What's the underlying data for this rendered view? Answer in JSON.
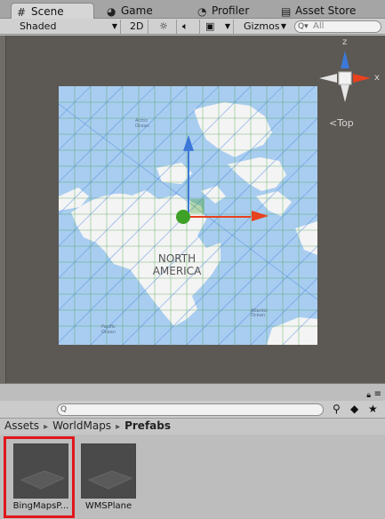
{
  "tabs": [
    {
      "label": "Scene",
      "icon": "hash-icon"
    },
    {
      "label": "Game",
      "icon": "pacman-icon"
    },
    {
      "label": "Profiler",
      "icon": "profiler-icon"
    },
    {
      "label": "Asset Store",
      "icon": "store-icon"
    }
  ],
  "toolbar": {
    "shading_mode": "Shaded",
    "mode_2d": "2D",
    "gizmos": "Gizmos",
    "search_placeholder": "All"
  },
  "scene": {
    "view_label": "Top",
    "axis_labels": {
      "x": "x",
      "z": "z"
    },
    "map_labels": {
      "continent": "NORTH\nAMERICA",
      "arctic_ocean": "Arctic\nOcean",
      "atlantic_ocean": "Atlantic\nOcean",
      "pacific_ocean": "Pacific\nOcean"
    },
    "colors": {
      "background": "#5c5853",
      "ocean": "#a9cdf0",
      "land": "#f4f4f4",
      "x_axis": "#e8411e",
      "y_axis": "#3d78d8",
      "pivot": "#3fa027"
    }
  },
  "project": {
    "breadcrumb": [
      "Assets",
      "WorldMaps",
      "Prefabs"
    ],
    "items": [
      {
        "label": "BingMapsP...",
        "selected": true
      },
      {
        "label": "WMSPlane",
        "selected": false
      }
    ],
    "selection_color": "#e0171d"
  }
}
